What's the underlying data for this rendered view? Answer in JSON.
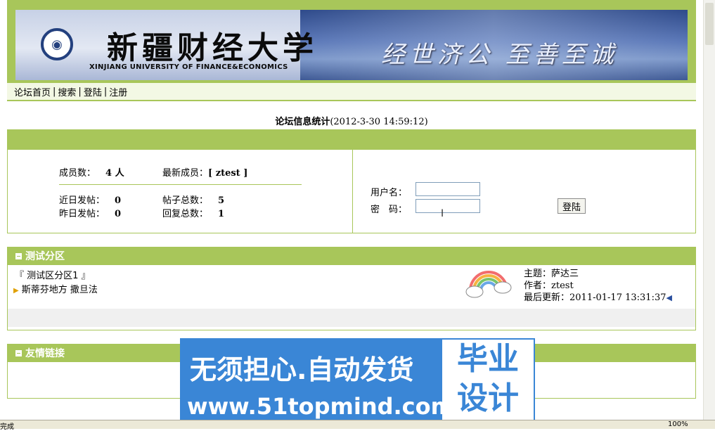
{
  "banner": {
    "name_cn": "新疆财经大学",
    "name_en": "XINJIANG UNIVERSITY OF FINANCE&ECONOMICS",
    "motto": "经世济公 至善至诚"
  },
  "nav": {
    "items": [
      "论坛首页",
      "搜索",
      "登陆",
      "注册"
    ],
    "separator": "|"
  },
  "stats": {
    "title": "论坛信息统计",
    "timestamp": "(2012-3-30 14:59:12)",
    "members_label": "成员数：",
    "members_value": "4 人",
    "newest_label": "最新成员：",
    "newest_value": "[ ztest ]",
    "recent_posts_label": "近日发帖：",
    "recent_posts_value": "0",
    "total_topics_label": "帖子总数：",
    "total_topics_value": "5",
    "yesterday_posts_label": "昨日发帖：",
    "yesterday_posts_value": "0",
    "total_replies_label": "回复总数：",
    "total_replies_value": "1"
  },
  "login": {
    "username_label": "用户名：",
    "password_label": "密　码：",
    "username_value": "",
    "password_value": "",
    "button_label": "登陆"
  },
  "section_test": {
    "title": "测试分区",
    "sub_title": "『 测试区分区1 』",
    "board_name": "斯蒂芬地方 撒旦法",
    "topic_label": "主题：",
    "topic_value": "萨达三",
    "author_label": "作者：",
    "author_value": "ztest",
    "updated_label": "最后更新：",
    "updated_value": "2011-01-17 13:31:37"
  },
  "section_links": {
    "title": "友情链接"
  },
  "watermark": {
    "line1": "无须担心.自动发货",
    "line2": "www.51topmind.com",
    "badge_line1": "毕业",
    "badge_line2": "设计"
  },
  "status": {
    "done": "完成",
    "zoom": "100%"
  },
  "colors": {
    "accent_green": "#a8c65a",
    "watermark_blue": "#3a86d6"
  }
}
